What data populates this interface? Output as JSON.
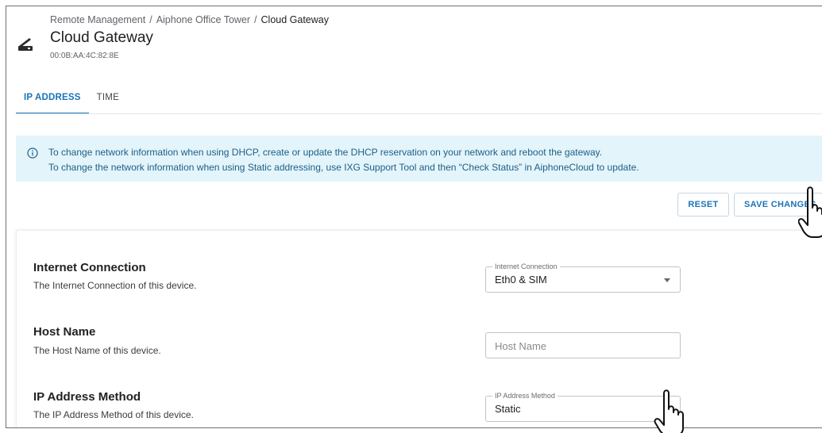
{
  "header": {
    "breadcrumb": [
      "Remote Management",
      "Aiphone Office Tower",
      "Cloud Gateway"
    ],
    "breadcrumb_separator": "/",
    "title": "Cloud Gateway",
    "mac_address": "00:0B:AA:4C:82:8E",
    "icon": "gateway-device-icon"
  },
  "tabs": [
    {
      "label": "IP ADDRESS",
      "active": true
    },
    {
      "label": "TIME",
      "active": false
    }
  ],
  "banner": {
    "icon": "info-icon",
    "line1": "To change network information when using DHCP, create or update the DHCP reservation on your network and reboot the gateway.",
    "line2": "To change the network information when using Static addressing, use IXG Support Tool and then “Check Status” in AiphoneCloud to update."
  },
  "actions": {
    "reset_label": "RESET",
    "save_label": "SAVE CHANGES"
  },
  "settings": {
    "internet_connection": {
      "title": "Internet Connection",
      "description": "The Internet Connection of this device.",
      "field_label": "Internet Connection",
      "value": "Eth0 & SIM"
    },
    "host_name": {
      "title": "Host Name",
      "description": "The Host Name of this device.",
      "placeholder": "Host Name",
      "value": ""
    },
    "ip_address_method": {
      "title": "IP Address Method",
      "description": "The IP Address Method of this device.",
      "field_label": "IP Address Method",
      "value": "Static"
    }
  },
  "colors": {
    "accent": "#1a73b8",
    "banner_bg": "#e3f4fb",
    "banner_text": "#1c5f86"
  }
}
